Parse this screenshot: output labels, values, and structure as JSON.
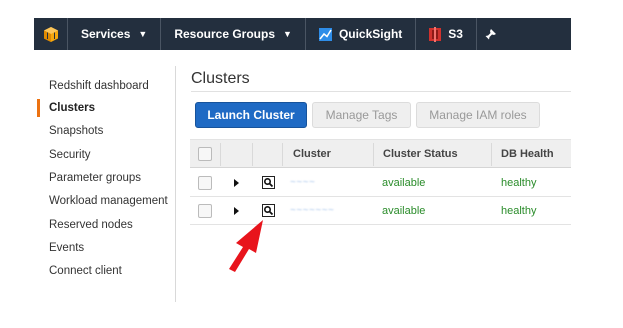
{
  "topnav": {
    "services": "Services",
    "resource_groups": "Resource Groups",
    "quicksight": "QuickSight",
    "s3": "S3"
  },
  "sidebar": {
    "items": [
      {
        "label": "Redshift dashboard",
        "active": false
      },
      {
        "label": "Clusters",
        "active": true
      },
      {
        "label": "Snapshots",
        "active": false
      },
      {
        "label": "Security",
        "active": false
      },
      {
        "label": "Parameter groups",
        "active": false
      },
      {
        "label": "Workload management",
        "active": false
      },
      {
        "label": "Reserved nodes",
        "active": false
      },
      {
        "label": "Events",
        "active": false
      },
      {
        "label": "Connect client",
        "active": false
      }
    ]
  },
  "main": {
    "title": "Clusters",
    "buttons": {
      "launch": "Launch Cluster",
      "tags": "Manage Tags",
      "iam": "Manage IAM roles"
    },
    "table": {
      "columns": [
        "Cluster",
        "Cluster Status",
        "DB Health"
      ],
      "rows": [
        {
          "cluster": "~~~~",
          "status": "available",
          "health": "healthy"
        },
        {
          "cluster": "~~~~~~~",
          "status": "available",
          "health": "healthy"
        }
      ]
    }
  },
  "colors": {
    "nav_bg": "#232f3e",
    "primary_button": "#1f6ac4",
    "status_green": "#2a8c2a",
    "active_marker": "#ec7211",
    "annotation_arrow": "#e8141c"
  }
}
